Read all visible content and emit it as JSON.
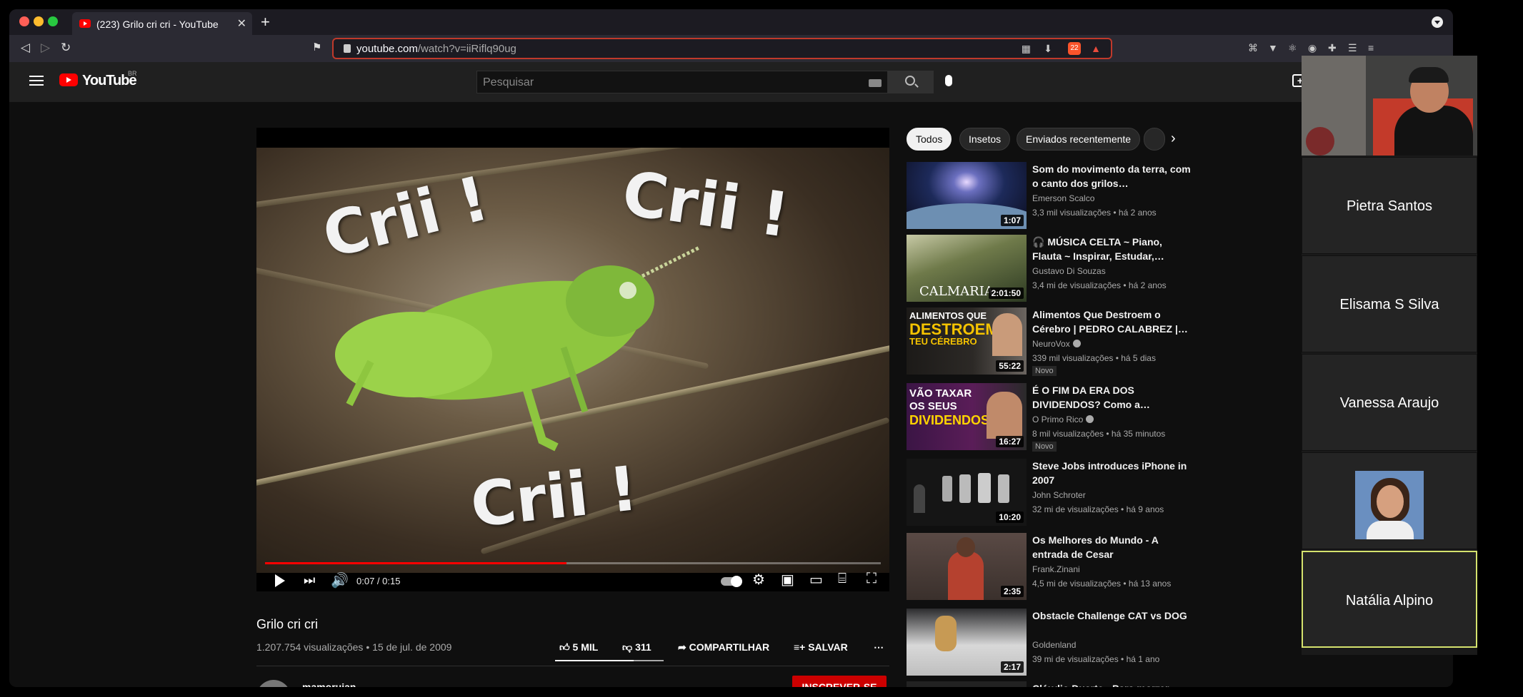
{
  "browser": {
    "tab_title": "(223) Grilo cri cri - YouTube",
    "url_host": "youtube.com",
    "url_path": "/watch?v=iiRiflq90ug",
    "brave_count": "22"
  },
  "youtube": {
    "logo_text": "YouTube",
    "country": "BR",
    "search_placeholder": "Pesquisar",
    "video": {
      "overlay_text": [
        "Crii !",
        "Crii !",
        "Crii !"
      ],
      "time": "0:07 / 0:15",
      "progress_fraction": 0.49,
      "title": "Grilo cri cri",
      "meta": "1.207.754 visualizações • 15 de jul. de 2009",
      "likes": "5 MIL",
      "dislikes": "311",
      "share": "COMPARTILHAR",
      "save": "SALVAR",
      "more": "⋯",
      "channel": "mamoruian",
      "subscribe": "INSCREVER-SE"
    },
    "chips": [
      "Todos",
      "Insetos",
      "Enviados recentemente"
    ],
    "related": [
      {
        "title": "Som do movimento da terra, com o canto dos grilos…",
        "channel": "Emerson Scalco",
        "meta": "3,3 mil visualizações • há 2 anos",
        "duration": "1:07",
        "verified": false,
        "badge": ""
      },
      {
        "title": "🎧 MÚSICA CELTA ~ Piano, Flauta ~ Inspirar, Estudar,…",
        "channel": "Gustavo Di Souzas",
        "meta": "3,4 mi de visualizações • há 2 anos",
        "duration": "2:01:50",
        "verified": false,
        "badge": "",
        "thumb_text": "CALMARIA"
      },
      {
        "title": "Alimentos Que Destroem o Cérebro | PEDRO CALABREZ |…",
        "channel": "NeuroVox",
        "meta": "339 mil visualizações • há 5 dias",
        "duration": "55:22",
        "verified": true,
        "badge": "Novo",
        "thumb_text": [
          "ALIMENTOS QUE",
          "DESTROEM",
          "TEU CÉREBRO"
        ]
      },
      {
        "title": "É O FIM DA ERA DOS DIVIDENDOS? Como a…",
        "channel": "O Primo Rico",
        "meta": "8 mil visualizações • há 35 minutos",
        "duration": "16:27",
        "verified": true,
        "badge": "Novo",
        "thumb_text": [
          "VÃO TAXAR",
          "OS SEUS",
          "DIVIDENDOS?"
        ]
      },
      {
        "title": "Steve Jobs introduces iPhone in 2007",
        "channel": "John Schroter",
        "meta": "32 mi de visualizações • há 9 anos",
        "duration": "10:20",
        "verified": false,
        "badge": ""
      },
      {
        "title": "Os Melhores do Mundo - A entrada de Cesar",
        "channel": "Frank.Zinani",
        "meta": "4,5 mi de visualizações • há 13 anos",
        "duration": "2:35",
        "verified": false,
        "badge": ""
      },
      {
        "title": "Obstacle Challenge CAT vs DOG",
        "channel": "Goldenland",
        "meta": "39 mi de visualizações • há 1 ano",
        "duration": "2:17",
        "verified": false,
        "badge": ""
      },
      {
        "title": "Cláudio Duarte - Para morrer",
        "channel": "",
        "meta": "",
        "duration": "",
        "verified": false,
        "badge": ""
      }
    ]
  },
  "zoom": {
    "participants": [
      "Pietra Santos",
      "Elisama S Silva",
      "Vanessa Araujo",
      "",
      "Natália Alpino"
    ],
    "active_speaker": "Natália Alpino"
  },
  "colors": {
    "youtube_red": "#ff0000",
    "progress_red": "#ff0000",
    "url_border": "#c0392b",
    "speaker_border": "#d5e36e"
  }
}
